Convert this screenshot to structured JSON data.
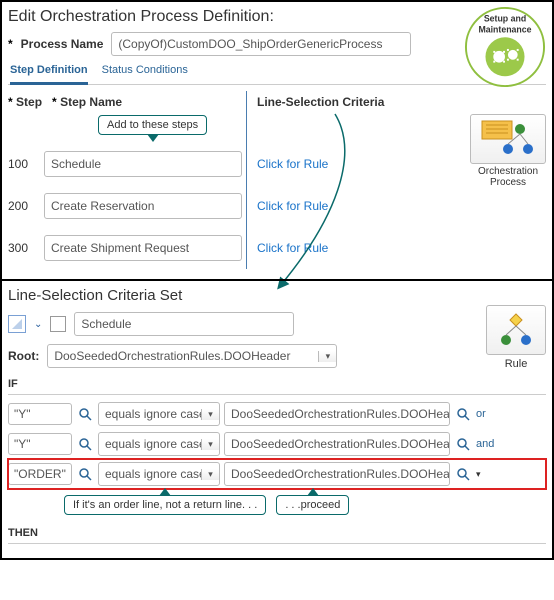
{
  "top": {
    "page_title": "Edit Orchestration Process Definition:",
    "process_name_label": "Process Name",
    "process_name_value": "(CopyOf)CustomDOO_ShipOrderGenericProcess",
    "tabs": {
      "step_def": "Step Definition",
      "status_cond": "Status Conditions"
    },
    "columns": {
      "step": "Step",
      "step_name": "Step Name",
      "line_sel": "Line-Selection Criteria"
    },
    "callout_add": "Add to these steps",
    "steps": [
      {
        "num": "100",
        "name": "Schedule",
        "link": "Click for Rule"
      },
      {
        "num": "200",
        "name": "Create Reservation",
        "link": "Click for Rule"
      },
      {
        "num": "300",
        "name": "Create Shipment Request",
        "link": "Click for Rule"
      }
    ],
    "badge_setup": "Setup and Maintenance",
    "badge_orch": "Orchestration Process"
  },
  "bottom": {
    "section_title": "Line-Selection Criteria Set",
    "toolbar_input": "Schedule",
    "root_label": "Root:",
    "root_value": "DooSeededOrchestrationRules.DOOHeader",
    "if_label": "IF",
    "then_label": "THEN",
    "conditions": [
      {
        "lhs": "\"Y\"",
        "op": "equals ignore case",
        "rhs": "DooSeededOrchestrationRules.DOOHeade",
        "conn": "or"
      },
      {
        "lhs": "\"Y\"",
        "op": "equals ignore case",
        "rhs": "DooSeededOrchestrationRules.DOOHeade",
        "conn": "and"
      },
      {
        "lhs": "\"ORDER\"",
        "op": "equals ignore case",
        "rhs": "DooSeededOrchestrationRules.DOOHeade",
        "conn": ""
      }
    ],
    "ann_if_order": "If it's an order line, not a return line. . .",
    "ann_proceed": ". . .proceed",
    "badge_rule": "Rule"
  }
}
